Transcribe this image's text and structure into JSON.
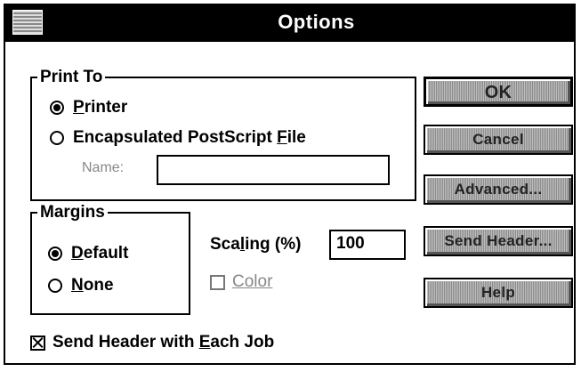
{
  "dialog": {
    "title": "Options",
    "print_to": {
      "legend": "Print To",
      "printer": {
        "label": "Printer",
        "mnemonic": "P",
        "rest": "rinter",
        "selected": true
      },
      "eps": {
        "label_prefix": "Encapsulated PostScript ",
        "mnemonic": "F",
        "label_suffix": "ile",
        "selected": false
      },
      "name_label": "Name:",
      "name_value": ""
    },
    "margins": {
      "legend": "Margins",
      "default": {
        "mnemonic": "D",
        "rest": "efault",
        "selected": true
      },
      "none": {
        "mnemonic": "N",
        "rest": "one",
        "selected": false
      }
    },
    "scaling": {
      "label_prefix": "Sca",
      "mnemonic": "l",
      "label_suffix": "ing (%)",
      "value": "100"
    },
    "color": {
      "label": "Color",
      "checked": false,
      "enabled": false
    },
    "send_header_each_job": {
      "label_prefix": "Send Header with ",
      "mnemonic": "E",
      "label_suffix": "ach Job",
      "checked": true
    },
    "buttons": {
      "ok": "OK",
      "cancel": "Cancel",
      "advanced": "Advanced...",
      "send_header": "Send Header...",
      "help": "Help"
    }
  }
}
